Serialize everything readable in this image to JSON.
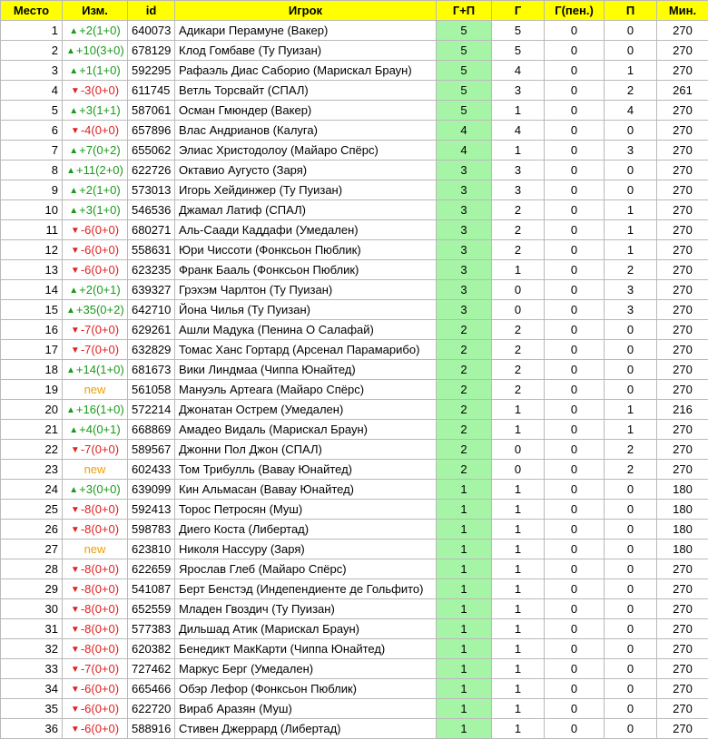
{
  "headers": {
    "place": "Место",
    "change": "Изм.",
    "id": "id",
    "player": "Игрок",
    "gp": "Г+П",
    "g": "Г",
    "gpen": "Г(пен.)",
    "p": "П",
    "min": "Мин."
  },
  "colors": {
    "header_bg": "#ffff00",
    "gp_bg": "#a6f5a6",
    "up": "#1a9a1a",
    "down": "#e02020",
    "new": "#f0a000"
  },
  "rows": [
    {
      "place": "1",
      "dir": "up",
      "change": "+2(1+0)",
      "id": "640073",
      "player": "Адикари Перамуне (Вакер)",
      "gp": "5",
      "g": "5",
      "gpen": "0",
      "p": "0",
      "min": "270"
    },
    {
      "place": "2",
      "dir": "up",
      "change": "+10(3+0)",
      "id": "678129",
      "player": "Клод Гомбаве (Ту Пуизан)",
      "gp": "5",
      "g": "5",
      "gpen": "0",
      "p": "0",
      "min": "270"
    },
    {
      "place": "3",
      "dir": "up",
      "change": "+1(1+0)",
      "id": "592295",
      "player": "Рафаэль Диас Саборио (Марискал Браун)",
      "gp": "5",
      "g": "4",
      "gpen": "0",
      "p": "1",
      "min": "270"
    },
    {
      "place": "4",
      "dir": "down",
      "change": "-3(0+0)",
      "id": "611745",
      "player": "Ветль Торсвайт (СПАЛ)",
      "gp": "5",
      "g": "3",
      "gpen": "0",
      "p": "2",
      "min": "261"
    },
    {
      "place": "5",
      "dir": "up",
      "change": "+3(1+1)",
      "id": "587061",
      "player": "Осман Гмюндер (Вакер)",
      "gp": "5",
      "g": "1",
      "gpen": "0",
      "p": "4",
      "min": "270"
    },
    {
      "place": "6",
      "dir": "down",
      "change": "-4(0+0)",
      "id": "657896",
      "player": "Влас Андрианов (Калуга)",
      "gp": "4",
      "g": "4",
      "gpen": "0",
      "p": "0",
      "min": "270"
    },
    {
      "place": "7",
      "dir": "up",
      "change": "+7(0+2)",
      "id": "655062",
      "player": "Элиас Христодолоу (Майаро Спёрс)",
      "gp": "4",
      "g": "1",
      "gpen": "0",
      "p": "3",
      "min": "270"
    },
    {
      "place": "8",
      "dir": "up",
      "change": "+11(2+0)",
      "id": "622726",
      "player": "Октавио Аугусто (Заря)",
      "gp": "3",
      "g": "3",
      "gpen": "0",
      "p": "0",
      "min": "270"
    },
    {
      "place": "9",
      "dir": "up",
      "change": "+2(1+0)",
      "id": "573013",
      "player": "Игорь Хейдинжер (Ту Пуизан)",
      "gp": "3",
      "g": "3",
      "gpen": "0",
      "p": "0",
      "min": "270"
    },
    {
      "place": "10",
      "dir": "up",
      "change": "+3(1+0)",
      "id": "546536",
      "player": "Джамал Латиф (СПАЛ)",
      "gp": "3",
      "g": "2",
      "gpen": "0",
      "p": "1",
      "min": "270"
    },
    {
      "place": "11",
      "dir": "down",
      "change": "-6(0+0)",
      "id": "680271",
      "player": "Аль-Саади Каддафи (Умедален)",
      "gp": "3",
      "g": "2",
      "gpen": "0",
      "p": "1",
      "min": "270"
    },
    {
      "place": "12",
      "dir": "down",
      "change": "-6(0+0)",
      "id": "558631",
      "player": "Юри Чиссоти (Фонксьон Пюблик)",
      "gp": "3",
      "g": "2",
      "gpen": "0",
      "p": "1",
      "min": "270"
    },
    {
      "place": "13",
      "dir": "down",
      "change": "-6(0+0)",
      "id": "623235",
      "player": "Франк Бааль (Фонксьон Пюблик)",
      "gp": "3",
      "g": "1",
      "gpen": "0",
      "p": "2",
      "min": "270"
    },
    {
      "place": "14",
      "dir": "up",
      "change": "+2(0+1)",
      "id": "639327",
      "player": "Грэхэм Чарлтон (Ту Пуизан)",
      "gp": "3",
      "g": "0",
      "gpen": "0",
      "p": "3",
      "min": "270"
    },
    {
      "place": "15",
      "dir": "up",
      "change": "+35(0+2)",
      "id": "642710",
      "player": "Йона Чилья (Ту Пуизан)",
      "gp": "3",
      "g": "0",
      "gpen": "0",
      "p": "3",
      "min": "270"
    },
    {
      "place": "16",
      "dir": "down",
      "change": "-7(0+0)",
      "id": "629261",
      "player": "Ашли Мадука (Пенина О Салафай)",
      "gp": "2",
      "g": "2",
      "gpen": "0",
      "p": "0",
      "min": "270"
    },
    {
      "place": "17",
      "dir": "down",
      "change": "-7(0+0)",
      "id": "632829",
      "player": "Томас Ханс Гортард (Арсенал Парамарибо)",
      "gp": "2",
      "g": "2",
      "gpen": "0",
      "p": "0",
      "min": "270"
    },
    {
      "place": "18",
      "dir": "up",
      "change": "+14(1+0)",
      "id": "681673",
      "player": "Вики Линдмаа (Чиппа Юнайтед)",
      "gp": "2",
      "g": "2",
      "gpen": "0",
      "p": "0",
      "min": "270"
    },
    {
      "place": "19",
      "dir": "new",
      "change": "new",
      "id": "561058",
      "player": "Мануэль Артеага (Майаро Спёрс)",
      "gp": "2",
      "g": "2",
      "gpen": "0",
      "p": "0",
      "min": "270"
    },
    {
      "place": "20",
      "dir": "up",
      "change": "+16(1+0)",
      "id": "572214",
      "player": "Джонатан Острем (Умедален)",
      "gp": "2",
      "g": "1",
      "gpen": "0",
      "p": "1",
      "min": "216"
    },
    {
      "place": "21",
      "dir": "up",
      "change": "+4(0+1)",
      "id": "668869",
      "player": "Амадео Видаль (Марискал Браун)",
      "gp": "2",
      "g": "1",
      "gpen": "0",
      "p": "1",
      "min": "270"
    },
    {
      "place": "22",
      "dir": "down",
      "change": "-7(0+0)",
      "id": "589567",
      "player": "Джонни Пол Джон (СПАЛ)",
      "gp": "2",
      "g": "0",
      "gpen": "0",
      "p": "2",
      "min": "270"
    },
    {
      "place": "23",
      "dir": "new",
      "change": "new",
      "id": "602433",
      "player": "Том Трибулль (Вавау Юнайтед)",
      "gp": "2",
      "g": "0",
      "gpen": "0",
      "p": "2",
      "min": "270"
    },
    {
      "place": "24",
      "dir": "up",
      "change": "+3(0+0)",
      "id": "639099",
      "player": "Кин Альмасан (Вавау Юнайтед)",
      "gp": "1",
      "g": "1",
      "gpen": "0",
      "p": "0",
      "min": "180"
    },
    {
      "place": "25",
      "dir": "down",
      "change": "-8(0+0)",
      "id": "592413",
      "player": "Торос Петросян (Муш)",
      "gp": "1",
      "g": "1",
      "gpen": "0",
      "p": "0",
      "min": "180"
    },
    {
      "place": "26",
      "dir": "down",
      "change": "-8(0+0)",
      "id": "598783",
      "player": "Диего Коста (Либертад)",
      "gp": "1",
      "g": "1",
      "gpen": "0",
      "p": "0",
      "min": "180"
    },
    {
      "place": "27",
      "dir": "new",
      "change": "new",
      "id": "623810",
      "player": "Николя Нассуру (Заря)",
      "gp": "1",
      "g": "1",
      "gpen": "0",
      "p": "0",
      "min": "180"
    },
    {
      "place": "28",
      "dir": "down",
      "change": "-8(0+0)",
      "id": "622659",
      "player": "Ярослав Глеб (Майаро Спёрс)",
      "gp": "1",
      "g": "1",
      "gpen": "0",
      "p": "0",
      "min": "270"
    },
    {
      "place": "29",
      "dir": "down",
      "change": "-8(0+0)",
      "id": "541087",
      "player": "Берт Бенстэд (Индепендиенте де Гольфито)",
      "gp": "1",
      "g": "1",
      "gpen": "0",
      "p": "0",
      "min": "270"
    },
    {
      "place": "30",
      "dir": "down",
      "change": "-8(0+0)",
      "id": "652559",
      "player": "Младен Гвоздич (Ту Пуизан)",
      "gp": "1",
      "g": "1",
      "gpen": "0",
      "p": "0",
      "min": "270"
    },
    {
      "place": "31",
      "dir": "down",
      "change": "-8(0+0)",
      "id": "577383",
      "player": "Дильшад Атик (Марискал Браун)",
      "gp": "1",
      "g": "1",
      "gpen": "0",
      "p": "0",
      "min": "270"
    },
    {
      "place": "32",
      "dir": "down",
      "change": "-8(0+0)",
      "id": "620382",
      "player": "Бенедикт МакКарти (Чиппа Юнайтед)",
      "gp": "1",
      "g": "1",
      "gpen": "0",
      "p": "0",
      "min": "270"
    },
    {
      "place": "33",
      "dir": "down",
      "change": "-7(0+0)",
      "id": "727462",
      "player": "Маркус Берг (Умедален)",
      "gp": "1",
      "g": "1",
      "gpen": "0",
      "p": "0",
      "min": "270"
    },
    {
      "place": "34",
      "dir": "down",
      "change": "-6(0+0)",
      "id": "665466",
      "player": "Обэр Лефор (Фонксьон Пюблик)",
      "gp": "1",
      "g": "1",
      "gpen": "0",
      "p": "0",
      "min": "270"
    },
    {
      "place": "35",
      "dir": "down",
      "change": "-6(0+0)",
      "id": "622720",
      "player": "Вираб Аразян (Муш)",
      "gp": "1",
      "g": "1",
      "gpen": "0",
      "p": "0",
      "min": "270"
    },
    {
      "place": "36",
      "dir": "down",
      "change": "-6(0+0)",
      "id": "588916",
      "player": "Стивен Джеррард (Либертад)",
      "gp": "1",
      "g": "1",
      "gpen": "0",
      "p": "0",
      "min": "270"
    }
  ]
}
